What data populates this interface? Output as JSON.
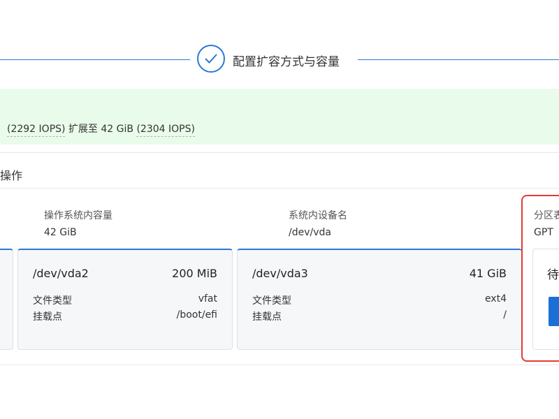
{
  "step": {
    "title": "配置扩容方式与容量"
  },
  "banner": {
    "iops_before": "(2292 IOPS)",
    "expand_text": "扩展至 42 GiB",
    "iops_after": "(2304 IOPS)"
  },
  "section": {
    "title_fragment": "操作"
  },
  "disk_info": {
    "os_capacity_label": "操作系统内容量",
    "os_capacity_value": "42 GiB",
    "device_name_label": "系统内设备名",
    "device_name_value": "/dev/vda",
    "partition_label_fragment": "分区表",
    "partition_value_fragment": "GPT"
  },
  "partitions": [
    {
      "name": "/dev/vda2",
      "size": "200 MiB",
      "fs_type_label": "文件类型",
      "fs_type": "vfat",
      "mount_label": "挂载点",
      "mount": "/boot/efi"
    },
    {
      "name": "/dev/vda3",
      "size": "41 GiB",
      "fs_type_label": "文件类型",
      "fs_type": "ext4",
      "mount_label": "挂载点",
      "mount": "/"
    }
  ],
  "pending": {
    "text_fragment": "待"
  },
  "colors": {
    "accent": "#2b78d8",
    "banner_bg": "#e9fbea",
    "highlight": "#e53935",
    "primary_button": "#1c6fd6"
  }
}
